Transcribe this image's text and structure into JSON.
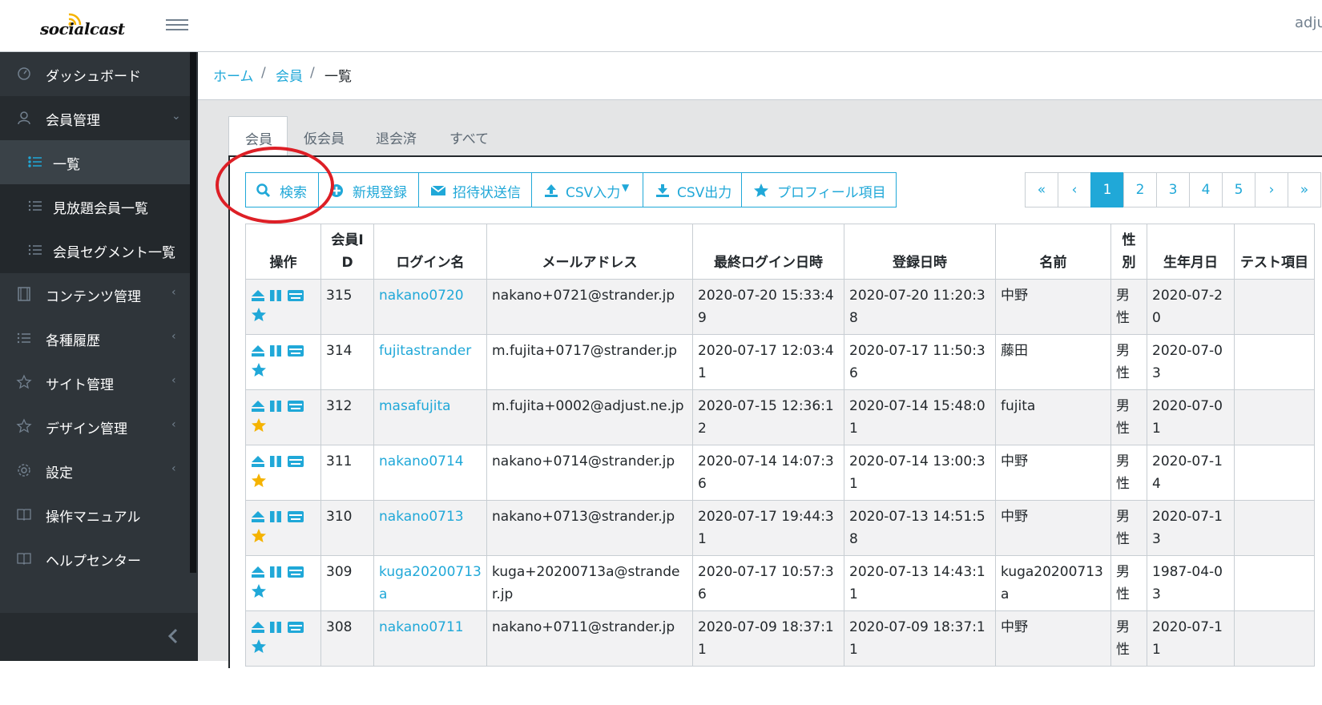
{
  "header": {
    "brand": "socialcast",
    "user": "adju"
  },
  "sidebar": {
    "items": [
      {
        "label": "ダッシュボード",
        "icon": "speedometer-icon"
      },
      {
        "label": "会員管理",
        "icon": "user-icon"
      },
      {
        "label": "一覧",
        "icon": "list-icon"
      },
      {
        "label": "見放題会員一覧",
        "icon": "list-icon"
      },
      {
        "label": "会員セグメント一覧",
        "icon": "list-icon"
      },
      {
        "label": "コンテンツ管理",
        "icon": "film-icon"
      },
      {
        "label": "各種履歴",
        "icon": "list-icon"
      },
      {
        "label": "サイト管理",
        "icon": "star-icon"
      },
      {
        "label": "デザイン管理",
        "icon": "star-icon"
      },
      {
        "label": "設定",
        "icon": "gear-icon"
      },
      {
        "label": "操作マニュアル",
        "icon": "book-icon"
      },
      {
        "label": "ヘルプセンター",
        "icon": "book-icon"
      }
    ]
  },
  "breadcrumb": {
    "home": "ホーム",
    "members": "会員",
    "current": "一覧",
    "separator": "/"
  },
  "tabs": [
    "会員",
    "仮会員",
    "退会済",
    "すべて"
  ],
  "toolbar": {
    "search": "検索",
    "register": "新規登録",
    "invite": "招待状送信",
    "csv_in": "CSV入力",
    "csv_out": "CSV出力",
    "profile": "プロフィール項目"
  },
  "pagination": {
    "first": "«",
    "prev": "‹",
    "pages": [
      "1",
      "2",
      "3",
      "4",
      "5"
    ],
    "next": "›",
    "last": "»",
    "current": "1"
  },
  "table": {
    "headers": [
      "操作",
      "会員ID",
      "ログイン名",
      "メールアドレス",
      "最終ログイン日時",
      "登録日時",
      "名前",
      "性別",
      "生年月日",
      "テスト項目"
    ],
    "rows": [
      {
        "id": "315",
        "login": "nakano0720",
        "email": "nakano+0721@strander.jp",
        "last_login": "2020-07-20 15:33:49",
        "registered": "2020-07-20 11:20:38",
        "name": "中野",
        "gender": "男性",
        "birth": "2020-07-20",
        "test": "",
        "starred": false
      },
      {
        "id": "314",
        "login": "fujitastrander",
        "email": "m.fujita+0717@strander.jp",
        "last_login": "2020-07-17 12:03:41",
        "registered": "2020-07-17 11:50:36",
        "name": "藤田",
        "gender": "男性",
        "birth": "2020-07-03",
        "test": "",
        "starred": false
      },
      {
        "id": "312",
        "login": "masafujita",
        "email": "m.fujita+0002@adjust.ne.jp",
        "last_login": "2020-07-15 12:36:12",
        "registered": "2020-07-14 15:48:01",
        "name": "fujita",
        "gender": "男性",
        "birth": "2020-07-01",
        "test": "",
        "starred": true
      },
      {
        "id": "311",
        "login": "nakano0714",
        "email": "nakano+0714@strander.jp",
        "last_login": "2020-07-14 14:07:36",
        "registered": "2020-07-14 13:00:31",
        "name": "中野",
        "gender": "男性",
        "birth": "2020-07-14",
        "test": "",
        "starred": true
      },
      {
        "id": "310",
        "login": "nakano0713",
        "email": "nakano+0713@strander.jp",
        "last_login": "2020-07-17 19:44:31",
        "registered": "2020-07-13 14:51:58",
        "name": "中野",
        "gender": "男性",
        "birth": "2020-07-13",
        "test": "",
        "starred": true
      },
      {
        "id": "309",
        "login": "kuga20200713a",
        "email": "kuga+20200713a@strander.jp",
        "last_login": "2020-07-17 10:57:36",
        "registered": "2020-07-13 14:43:11",
        "name": "kuga20200713a",
        "gender": "男性",
        "birth": "1987-04-03",
        "test": "",
        "starred": false
      },
      {
        "id": "308",
        "login": "nakano0711",
        "email": "nakano+0711@strander.jp",
        "last_login": "2020-07-09 18:37:11",
        "registered": "2020-07-09 18:37:11",
        "name": "中野",
        "gender": "男性",
        "birth": "2020-07-11",
        "test": "",
        "starred": false
      }
    ]
  },
  "colors": {
    "accent": "#20a8d8",
    "sidebar": "#2f353a",
    "star_gold": "#f5b301",
    "highlight_circle": "#dd1f26"
  }
}
